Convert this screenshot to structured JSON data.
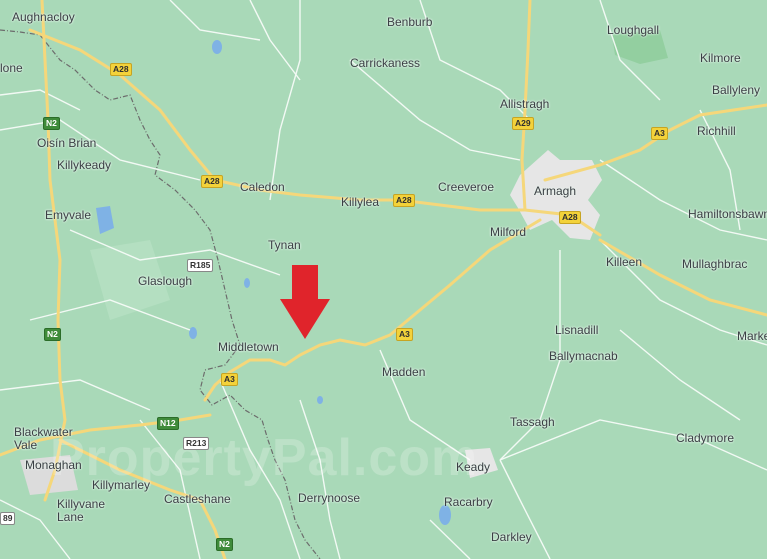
{
  "map": {
    "places": {
      "aughnacloy": "Aughnacloy",
      "benburb": "Benburb",
      "loughgall": "Loughgall",
      "carrickaness": "Carrickaness",
      "kilmore": "Kilmore",
      "ballyleny": "Ballyleny",
      "lone": "lone",
      "allistragh": "Allistragh",
      "richhill": "Richhill",
      "oisin_brian": "Oisín Brian",
      "killykeady": "Killykeady",
      "caledon": "Caledon",
      "killylea": "Killylea",
      "creeveroe": "Creeveroe",
      "armagh": "Armagh",
      "emyvale": "Emyvale",
      "hamiltonsbawn": "Hamiltonsbawn",
      "tynan": "Tynan",
      "milford": "Milford",
      "killeen": "Killeen",
      "mullaghbrack": "Mullaghbrac",
      "glaslough": "Glaslough",
      "lisnadill": "Lisnadill",
      "markethill": "Marke",
      "middletown": "Middletown",
      "ballymacnab": "Ballymacnab",
      "madden": "Madden",
      "blackwater_vale": "Blackwater\nVale",
      "tassagh": "Tassagh",
      "cladymore": "Cladymore",
      "monaghan": "Monaghan",
      "keady": "Keady",
      "killymarley": "Killymarley",
      "castleshane": "Castleshane",
      "derrynoose": "Derrynoose",
      "racarbry": "Racarbry",
      "killyvane_lane": "Killyvane\nLane",
      "darkley": "Darkley"
    },
    "road_shields": {
      "a28_north": "A28",
      "n2_north": "N2",
      "a29": "A29",
      "a3_east": "A3",
      "a28_caledon": "A28",
      "a28_killylea": "A28",
      "a28_armagh": "A28",
      "r185": "R185",
      "n2_mid": "N2",
      "a3_centre": "A3",
      "a3_middletown": "A3",
      "n12": "N12",
      "r213": "R213",
      "n2_south": "N2",
      "edge_89": "89"
    },
    "watermark": "PropertyPal.com",
    "marker_icon": "red-down-arrow",
    "colors": {
      "land": "#a9d9b8",
      "road_major": "#f5d77a",
      "road_minor": "#ffffff",
      "town": "#e6e6e6",
      "water": "#7fb2e5",
      "marker": "#e0242b",
      "border": "#6c6c6c"
    }
  }
}
